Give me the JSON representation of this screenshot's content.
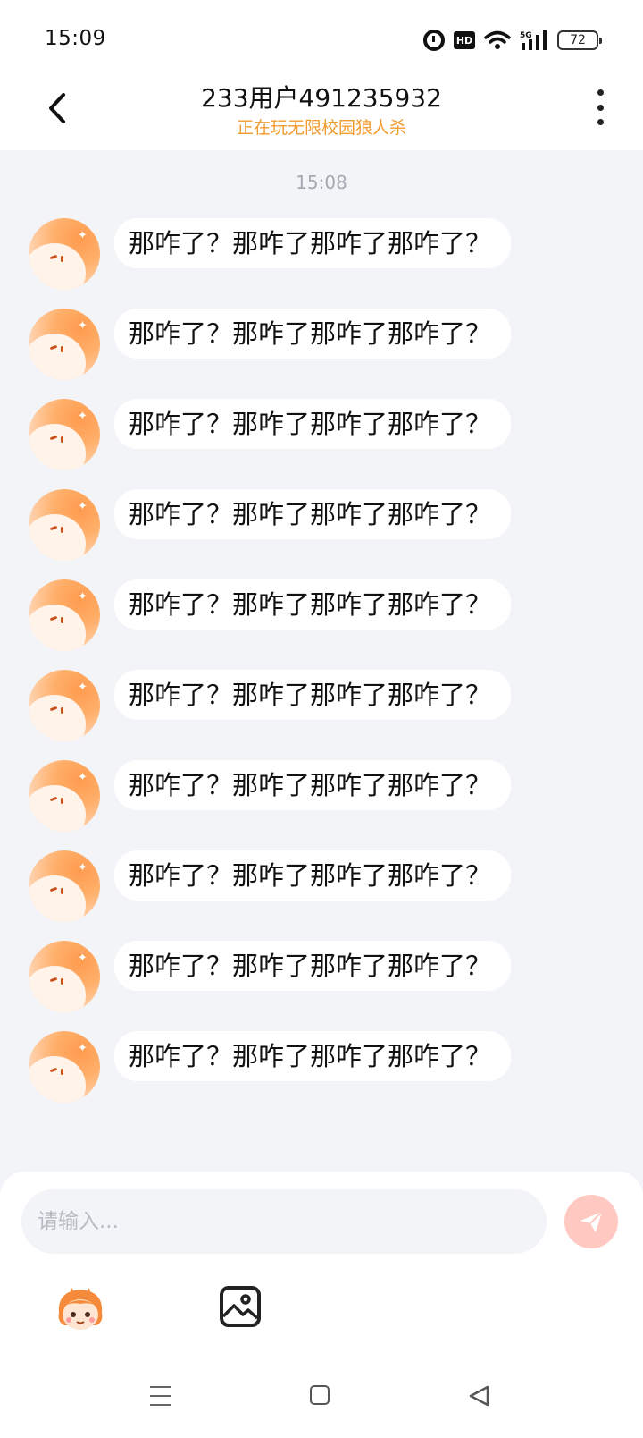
{
  "status_bar": {
    "time": "15:09",
    "icons": [
      "alarm-icon",
      "hd-icon",
      "wifi-icon",
      "5g-signal-icon",
      "battery-icon"
    ],
    "hd_label": "HD",
    "network_label": "5G",
    "battery_level": "72"
  },
  "header": {
    "title": "233用户491235932",
    "subtitle": "正在玩无限校园狼人杀",
    "subtitle_color": "#f39a2c",
    "back_icon": "chevron-left-icon",
    "more_icon": "more-vertical-icon"
  },
  "chat": {
    "timestamp": "15:08",
    "messages": [
      {
        "text": "那咋了？那咋了那咋了那咋了？"
      },
      {
        "text": "那咋了？那咋了那咋了那咋了？"
      },
      {
        "text": "那咋了？那咋了那咋了那咋了？"
      },
      {
        "text": "那咋了？那咋了那咋了那咋了？"
      },
      {
        "text": "那咋了？那咋了那咋了那咋了？"
      },
      {
        "text": "那咋了？那咋了那咋了那咋了？"
      },
      {
        "text": "那咋了？那咋了那咋了那咋了？"
      },
      {
        "text": "那咋了？那咋了那咋了那咋了？"
      },
      {
        "text": "那咋了？那咋了那咋了那咋了？"
      },
      {
        "text": "那咋了？那咋了那咋了那咋了？"
      }
    ]
  },
  "composer": {
    "placeholder": "请输入...",
    "value": "",
    "send_icon": "send-icon",
    "tools": [
      "emoji-mascot-icon",
      "image-icon"
    ]
  },
  "nav_bar": {
    "icons": [
      "menu-icon",
      "home-icon",
      "back-triangle-icon"
    ]
  },
  "colors": {
    "accent": "#f39a2c",
    "background": "#f3f4f8",
    "bubble": "#ffffff",
    "send_button": "#ffc9c2"
  }
}
